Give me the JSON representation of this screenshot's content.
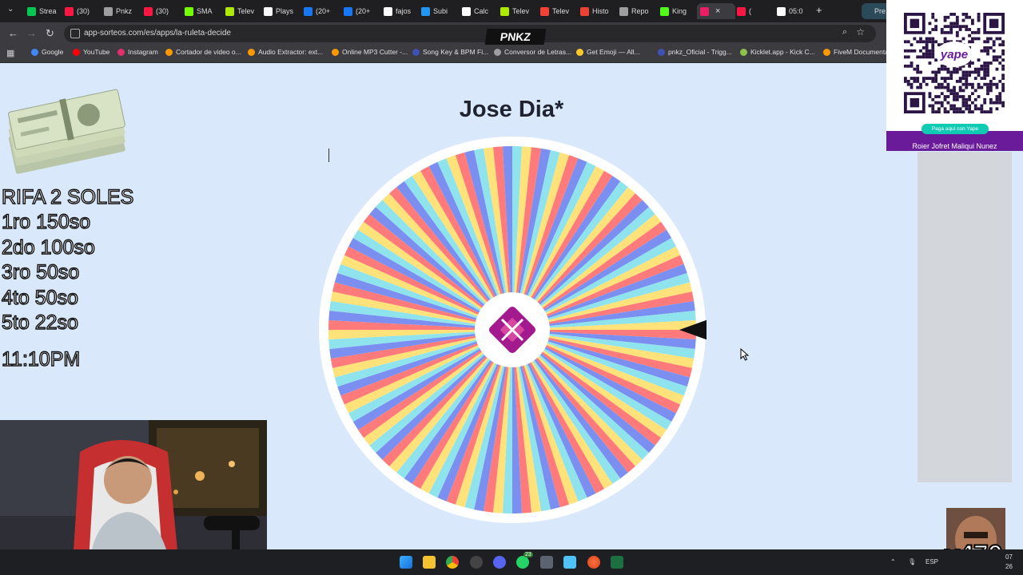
{
  "browser": {
    "tabs": [
      {
        "label": "Strea",
        "color": "#00c853"
      },
      {
        "label": "(30)",
        "color": "#ff1744"
      },
      {
        "label": "Pnkz",
        "color": "#9e9e9e"
      },
      {
        "label": "(30)",
        "color": "#ff1744"
      },
      {
        "label": "SMA",
        "color": "#76ff03"
      },
      {
        "label": "Telev",
        "color": "#aeea00"
      },
      {
        "label": "Plays",
        "color": "#fafafa"
      },
      {
        "label": "(20+",
        "color": "#1877f2"
      },
      {
        "label": "(20+",
        "color": "#1877f2"
      },
      {
        "label": "fajos",
        "color": "#ffffff"
      },
      {
        "label": "Subi",
        "color": "#2196f3"
      },
      {
        "label": "Calc",
        "color": "#ffffff"
      },
      {
        "label": "Telev",
        "color": "#aeea00"
      },
      {
        "label": "Telev",
        "color": "#f44336"
      },
      {
        "label": "Histo",
        "color": "#ea4335"
      },
      {
        "label": "Repo",
        "color": "#9e9e9e"
      },
      {
        "label": "King",
        "color": "#53fc18"
      },
      {
        "label": "",
        "color": "#e91e63"
      },
      {
        "label": "(",
        "color": "#ff1744"
      },
      {
        "label": "05:0",
        "color": "#ffffff"
      }
    ],
    "new_tab": "+",
    "right_tab": "Pre",
    "url": "app-sorteos.com/es/apps/la-ruleta-decide",
    "bookmarks": [
      {
        "label": "Google",
        "color": "#4285f4"
      },
      {
        "label": "YouTube",
        "color": "#ff0000"
      },
      {
        "label": "Instagram",
        "color": "#e1306c"
      },
      {
        "label": "Cortador de video o...",
        "color": "#ff9800"
      },
      {
        "label": "Audio Extractor: ext...",
        "color": "#ff9800"
      },
      {
        "label": "Online MP3 Cutter -...",
        "color": "#ff9800"
      },
      {
        "label": "Song Key & BPM Fi...",
        "color": "#3f51b5"
      },
      {
        "label": "Conversor de Letras...",
        "color": "#9e9e9e"
      },
      {
        "label": "Get Emoji — All...",
        "color": "#ffca28"
      },
      {
        "label": "pnkz_Oficial - Trigg...",
        "color": "#3f51b5"
      },
      {
        "label": "Kicklet.app - Kick C...",
        "color": "#8bc34a"
      },
      {
        "label": "FiveM Documentati...",
        "color": "#ff9800"
      }
    ]
  },
  "overlay": {
    "brand": "PNKZ",
    "rifa_lines": [
      "RIFA 2 SOLES",
      "1ro 150so",
      "2do 100so",
      "3ro 50so",
      "4to 50so",
      "5to 22so"
    ],
    "time": "11:10PM",
    "qr_button": "Paga aquí con Yape",
    "qr_name": "Roier Jofret Maliqui Nunez",
    "yape_logo": "yape",
    "meme_text": "x470"
  },
  "page": {
    "title": "Jose Dia*"
  },
  "wheel": {
    "segments": 120,
    "colors": [
      "#ff7b7b",
      "#7b8ff0",
      "#8fe3ec",
      "#ffe27a"
    ],
    "center_icon": "sorteos-logo-icon",
    "center_color": "#a31a8e"
  },
  "taskbar": {
    "lang": "ESP",
    "clock_top": "07",
    "clock_bottom": "26",
    "badge_whatsapp": "23"
  }
}
